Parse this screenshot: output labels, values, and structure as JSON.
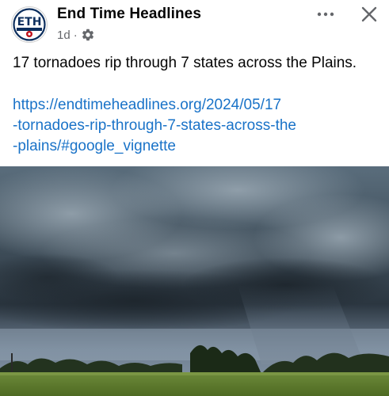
{
  "post": {
    "page_name": "End Time Headlines",
    "time_ago": "1d",
    "separator": "·",
    "audience_icon": "gear-icon",
    "more_icon": "more-options-icon",
    "close_icon": "close-icon",
    "avatar": {
      "initials": "ETH",
      "tagline": "END TIME HEADLINES",
      "colors": {
        "ring": "#0d2f5e",
        "bar": "#c0121b",
        "text": "#ffffff"
      }
    },
    "text": "17 tornadoes rip through 7 states across the Plains.",
    "link_lines": [
      "https://endtimeheadlines.org/2024/05/17",
      "-tornadoes-rip-through-7-states-across-the",
      "-plains/#google_vignette"
    ],
    "link_color": "#1a73c8",
    "image": {
      "subject": "storm-clouds-over-green-field",
      "description_icon": "photo-icon"
    }
  }
}
